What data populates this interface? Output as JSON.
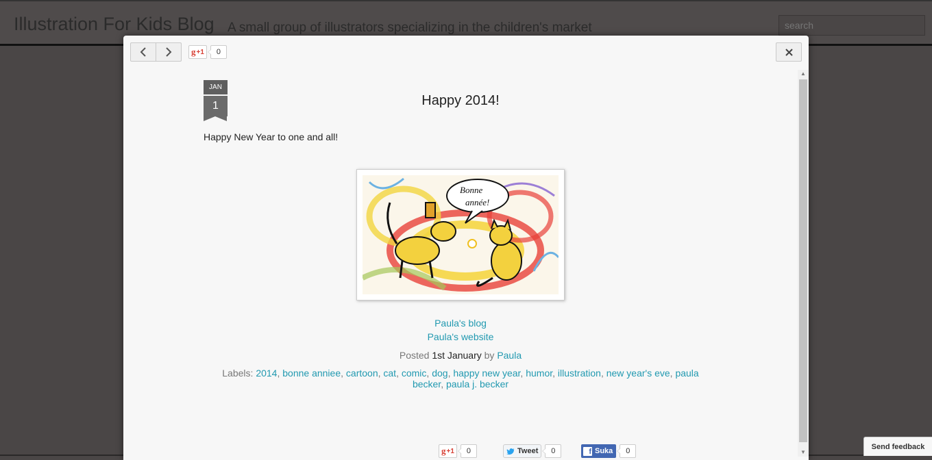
{
  "blog": {
    "title": "Illustration For Kids Blog",
    "description": "A small group of illustrators specializing in the children's market",
    "search_placeholder": "search"
  },
  "modal": {
    "plusone_label": "+1",
    "plusone_count": "0",
    "close_label": "×"
  },
  "post": {
    "date_month": "JAN",
    "date_day": "1",
    "title": "Happy 2014!",
    "body": "Happy New Year to one and all!",
    "image_alt_text": "Bonne année!",
    "links": [
      "Paula's blog",
      "Paula's website"
    ],
    "posted_prefix": "Posted",
    "posted_date": "1st January",
    "posted_by": "by",
    "author": "Paula",
    "labels_prefix": "Labels:",
    "labels": [
      "2014",
      "bonne anniee",
      "cartoon",
      "cat",
      "comic",
      "dog",
      "happy new year",
      "humor",
      "illustration",
      "new year's eve",
      "paula becker",
      "paula j. becker"
    ]
  },
  "share": {
    "gplus_label": "+1",
    "gplus_count": "0",
    "tweet_label": "Tweet",
    "tweet_count": "0",
    "fb_label": "Suka",
    "fb_count": "0"
  },
  "feedback_label": "Send feedback",
  "colors": {
    "link": "#2199b0",
    "overlay_bg": "#4a4646",
    "modal_bg": "#f7f7f7",
    "date_badge": "#6b6b6b"
  }
}
